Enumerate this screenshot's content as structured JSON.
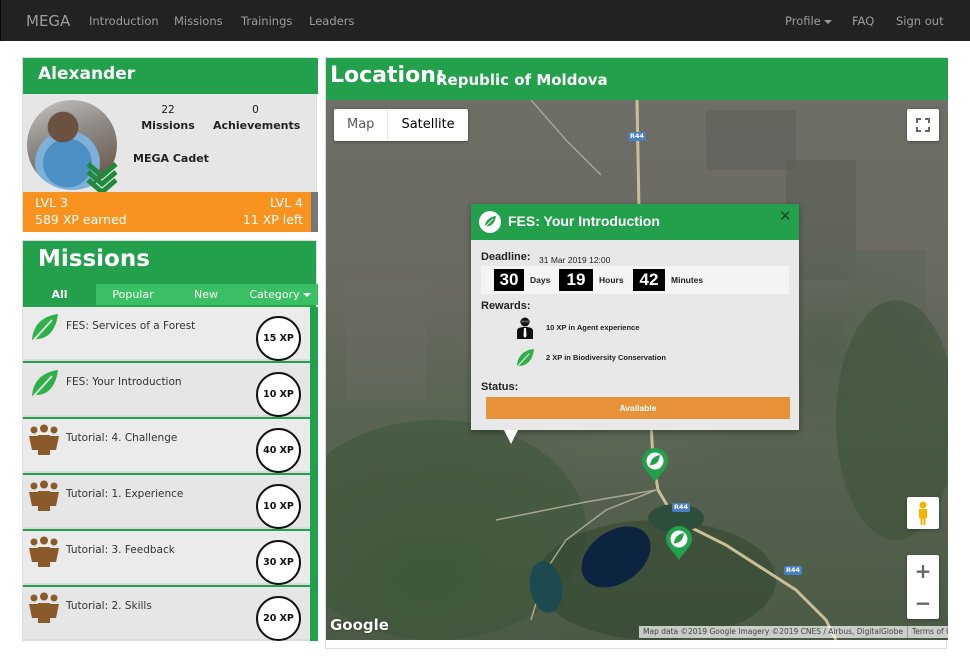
{
  "navbar": {
    "brand": "MEGA",
    "left_items": [
      "Introduction",
      "Missions",
      "Trainings",
      "Leaders"
    ],
    "right_items": [
      {
        "label": "Profile",
        "dropdown": true
      },
      {
        "label": "FAQ",
        "dropdown": false
      },
      {
        "label": "Sign out",
        "dropdown": false
      }
    ]
  },
  "profile": {
    "name": "Alexander",
    "missions_count": "22",
    "missions_label": "Missions",
    "achievements_count": "0",
    "achievements_label": "Achievements",
    "rank": "MEGA Cadet",
    "current_level": "LVL 3",
    "next_level": "LVL 4",
    "xp_earned": "589 XP earned",
    "xp_left": "11 XP left",
    "rank_icon": "double-chevron-down-icon"
  },
  "missions": {
    "title": "Missions",
    "tabs": [
      {
        "label": "All",
        "active": true
      },
      {
        "label": "Popular",
        "active": false
      },
      {
        "label": "New",
        "active": false
      },
      {
        "label": "Category",
        "active": false,
        "dropdown": true
      }
    ],
    "items": [
      {
        "name": "FES: Services of a Forest",
        "xp": "15 XP",
        "icon": "leaf-icon"
      },
      {
        "name": "FES: Your Introduction",
        "xp": "10 XP",
        "icon": "leaf-icon"
      },
      {
        "name": "Tutorial: 4. Challenge",
        "xp": "40 XP",
        "icon": "group-icon"
      },
      {
        "name": "Tutorial: 1. Experience",
        "xp": "10 XP",
        "icon": "group-icon"
      },
      {
        "name": "Tutorial: 3. Feedback",
        "xp": "30 XP",
        "icon": "group-icon"
      },
      {
        "name": "Tutorial: 2. Skills",
        "xp": "20 XP",
        "icon": "group-icon"
      }
    ]
  },
  "location": {
    "label": "Location:",
    "value": "Republic of Moldova"
  },
  "map": {
    "type_options": [
      "Map",
      "Satellite"
    ],
    "selected_type": "Satellite",
    "fullscreen_icon": "fullscreen-icon",
    "pegman_icon": "pegman-icon",
    "zoom_in": "+",
    "zoom_out": "−",
    "logo": "Google",
    "attribution": "Map data ©2019 Google Imagery ©2019 CNES / Airbus, DigitalGlobe",
    "terms": "Terms of Use",
    "route_label": "R44"
  },
  "info_window": {
    "title": "FES: Your Introduction",
    "close": "✕",
    "deadline_label": "Deadline:",
    "deadline_value": "31 Mar 2019 12:00",
    "countdown": [
      {
        "value": "30",
        "unit": "Days"
      },
      {
        "value": "19",
        "unit": "Hours"
      },
      {
        "value": "42",
        "unit": "Minutes"
      }
    ],
    "rewards_label": "Rewards:",
    "rewards": [
      {
        "text": "10 XP in Agent experience",
        "icon": "agent-icon"
      },
      {
        "text": "2 XP in Biodiversity Conservation",
        "icon": "leaf-icon"
      }
    ],
    "status_label": "Status:",
    "status_value": "Available"
  },
  "colors": {
    "brand_green": "#22a04b",
    "tab_green": "#3bbf64",
    "xp_orange": "#f7931e",
    "status_orange": "#e8923a",
    "navbar": "#222222",
    "tutorial_brown": "#8b5a2b"
  }
}
